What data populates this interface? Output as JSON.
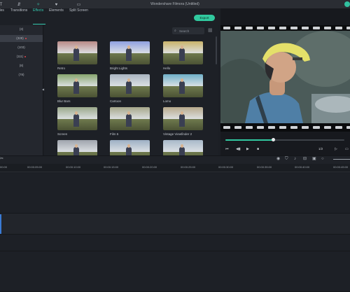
{
  "window": {
    "title": "Wondershare Filmora (Untitled)"
  },
  "toolbar": {
    "tabs": [
      {
        "label": "itles",
        "icon": "title-icon"
      },
      {
        "label": "Transitions",
        "icon": "transitions-icon"
      },
      {
        "label": "Effects",
        "icon": "effects-icon",
        "active": true
      },
      {
        "label": "Elements",
        "icon": "elements-icon"
      },
      {
        "label": "Split Screen",
        "icon": "split-screen-icon"
      }
    ],
    "export_label": "Export"
  },
  "categories": [
    {
      "label": "(3)",
      "selected": false,
      "badge": false
    },
    {
      "label": "(328)",
      "selected": true,
      "badge": true
    },
    {
      "label": "(103)",
      "selected": false,
      "badge": false
    },
    {
      "label": "(111)",
      "selected": false,
      "badge": true
    },
    {
      "label": "(8)",
      "selected": false,
      "badge": false
    },
    {
      "label": "(78)",
      "selected": false,
      "badge": false
    }
  ],
  "search": {
    "placeholder": "Search"
  },
  "effects": [
    {
      "label": "Retro",
      "tint": "#b98a86"
    },
    {
      "label": "Bright Lights",
      "tint": "#8fa0e0"
    },
    {
      "label": "Hello",
      "tint": "#c9b36a"
    },
    {
      "label": "Blur Bars",
      "tint": "#87a56e"
    },
    {
      "label": "Cartoon",
      "tint": "#a9b4c0"
    },
    {
      "label": "Lomo",
      "tint": "#6fb0c8"
    },
    {
      "label": "Screen",
      "tint": "#9aa88a"
    },
    {
      "label": "Film 5",
      "tint": "#a6a78a"
    },
    {
      "label": "Vintage Viewfinder 2",
      "tint": "#b7a98b"
    },
    {
      "label": "",
      "tint": "#9fa4ad"
    },
    {
      "label": "",
      "tint": "#9db0c4"
    },
    {
      "label": "",
      "tint": "#a8b9c9"
    }
  ],
  "preview": {
    "progress": 0.4,
    "ratio": "1/2"
  },
  "ruler": {
    "ticks": [
      "00:00",
      "00:00:05:00",
      "00:00:10:00",
      "00:00:15:00",
      "00:00:20:00",
      "00:00:25:00",
      "00:00:30:00",
      "00:00:35:00",
      "00:00:40:00",
      "00:00:45:00"
    ]
  },
  "colors": {
    "accent": "#31c9a0",
    "badge": "#e0464e"
  }
}
